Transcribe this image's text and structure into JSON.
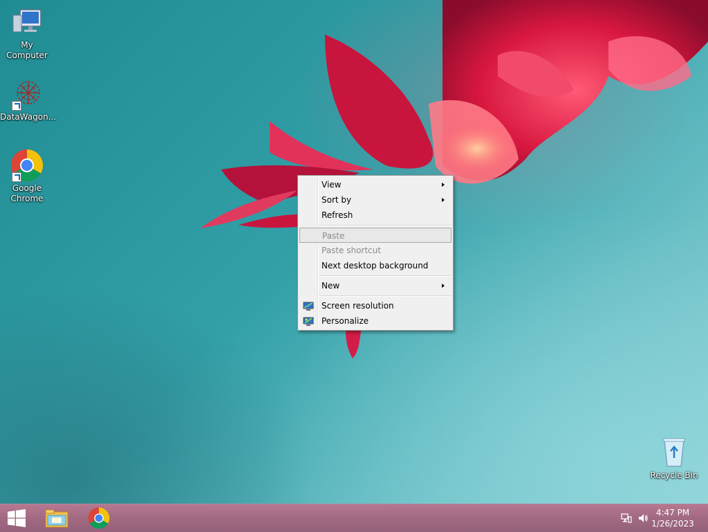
{
  "desktop": {
    "icons": [
      {
        "label": "My Computer",
        "icon": "computer-icon"
      },
      {
        "label": "DataWagon...",
        "icon": "datawagon-icon"
      },
      {
        "label": "Google Chrome",
        "icon": "chrome-icon"
      },
      {
        "label": "Recycle Bin",
        "icon": "recycle-bin-icon"
      }
    ]
  },
  "context_menu": {
    "items": [
      {
        "label": "View",
        "submenu": true,
        "disabled": false
      },
      {
        "label": "Sort by",
        "submenu": true,
        "disabled": false
      },
      {
        "label": "Refresh",
        "submenu": false,
        "disabled": false
      },
      {
        "label": "Paste",
        "submenu": false,
        "disabled": true,
        "highlighted": true
      },
      {
        "label": "Paste shortcut",
        "submenu": false,
        "disabled": true
      },
      {
        "label": "Next desktop background",
        "submenu": false,
        "disabled": false
      },
      {
        "label": "New",
        "submenu": true,
        "disabled": false
      },
      {
        "label": "Screen resolution",
        "submenu": false,
        "disabled": false,
        "icon": "screen-resolution-icon"
      },
      {
        "label": "Personalize",
        "submenu": false,
        "disabled": false,
        "icon": "personalize-icon"
      }
    ]
  },
  "taskbar": {
    "pinned": [
      "start-button",
      "file-explorer-icon",
      "chrome-icon"
    ],
    "tray": [
      "network-icon",
      "volume-icon"
    ],
    "clock": {
      "time": "4:47 PM",
      "date": "1/26/2023"
    }
  },
  "colors": {
    "taskbar": "#a26a82",
    "menu_bg": "#f0f0f0",
    "desktop": "#2f9aa2"
  }
}
